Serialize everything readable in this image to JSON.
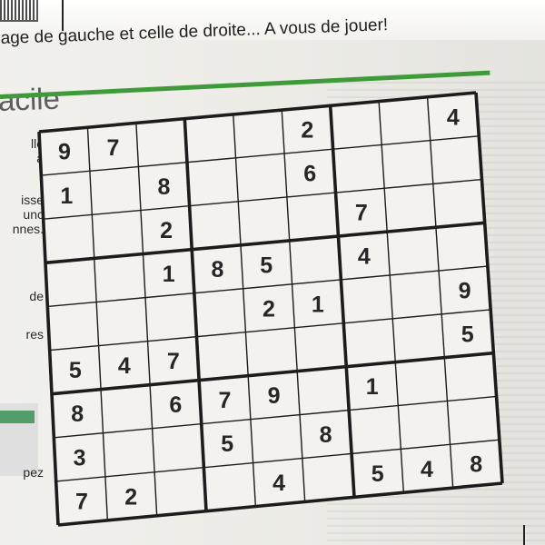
{
  "intro_text": "age de gauche et celle de droite... A vous de jouer!",
  "heading": "acile",
  "side_text": [
    {
      "id": "a",
      "lines": [
        "lle",
        "à"
      ]
    },
    {
      "id": "b",
      "lines": [
        "isse",
        "unc",
        "nnes."
      ]
    },
    {
      "id": "c",
      "lines": [
        "de"
      ]
    },
    {
      "id": "d",
      "lines": [
        "res"
      ]
    },
    {
      "id": "e",
      "lines": [
        "pez"
      ]
    }
  ],
  "sudoku": {
    "difficulty": "facile",
    "grid": [
      [
        "9",
        "7",
        "",
        "",
        "",
        "2",
        "",
        "",
        "4"
      ],
      [
        "1",
        "",
        "8",
        "",
        "",
        "6",
        "",
        "",
        ""
      ],
      [
        "",
        "",
        "2",
        "",
        "",
        "",
        "7",
        "",
        ""
      ],
      [
        "",
        "",
        "1",
        "8",
        "5",
        "",
        "4",
        "",
        ""
      ],
      [
        "",
        "",
        "",
        "",
        "",
        "",
        "",
        "",
        "9"
      ],
      [
        "5",
        "4",
        "7",
        "",
        "2",
        "1",
        "",
        "",
        ""
      ],
      [
        "",
        "",
        "",
        "",
        "",
        "",
        "1",
        "",
        "5"
      ],
      [
        "8",
        "",
        "6",
        "7",
        "9",
        "",
        "",
        "",
        ""
      ],
      [
        "",
        "",
        "",
        "5",
        "",
        "8",
        "",
        "",
        ""
      ],
      [
        "3",
        "",
        "",
        "",
        "",
        "",
        "",
        "5",
        "4"
      ],
      [
        "",
        "",
        "",
        "",
        "",
        "",
        "",
        "",
        ""
      ],
      [
        "",
        "",
        "",
        "",
        "4",
        "",
        "",
        "8",
        ""
      ],
      [
        "7",
        "2",
        "",
        "",
        "",
        "",
        "",
        "",
        ""
      ]
    ],
    "cells": [
      [
        "9",
        "7",
        "",
        "",
        "",
        "2",
        "",
        "",
        "4"
      ],
      [
        "1",
        "",
        "8",
        "",
        "",
        "6",
        "",
        "",
        ""
      ],
      [
        "",
        "",
        "2",
        "",
        "",
        "",
        "7",
        "",
        ""
      ],
      [
        "",
        "",
        "1",
        "8",
        "5",
        "",
        "4",
        "",
        ""
      ],
      [
        "",
        "",
        "",
        "",
        "2",
        "1",
        "",
        "",
        "9"
      ],
      [
        "5",
        "4",
        "7",
        "",
        "",
        "",
        "",
        "",
        "5"
      ],
      [
        "8",
        "",
        "6",
        "7",
        "9",
        "",
        "1",
        "",
        ""
      ],
      [
        "3",
        "",
        "",
        "5",
        "",
        "8",
        "",
        "",
        ""
      ],
      [
        "7",
        "2",
        "",
        "",
        "4",
        "",
        "5",
        "4",
        "8"
      ]
    ]
  },
  "colors": {
    "accent_rule": "#3f9a3a",
    "ink": "#262626",
    "paper": "#efeeea"
  }
}
